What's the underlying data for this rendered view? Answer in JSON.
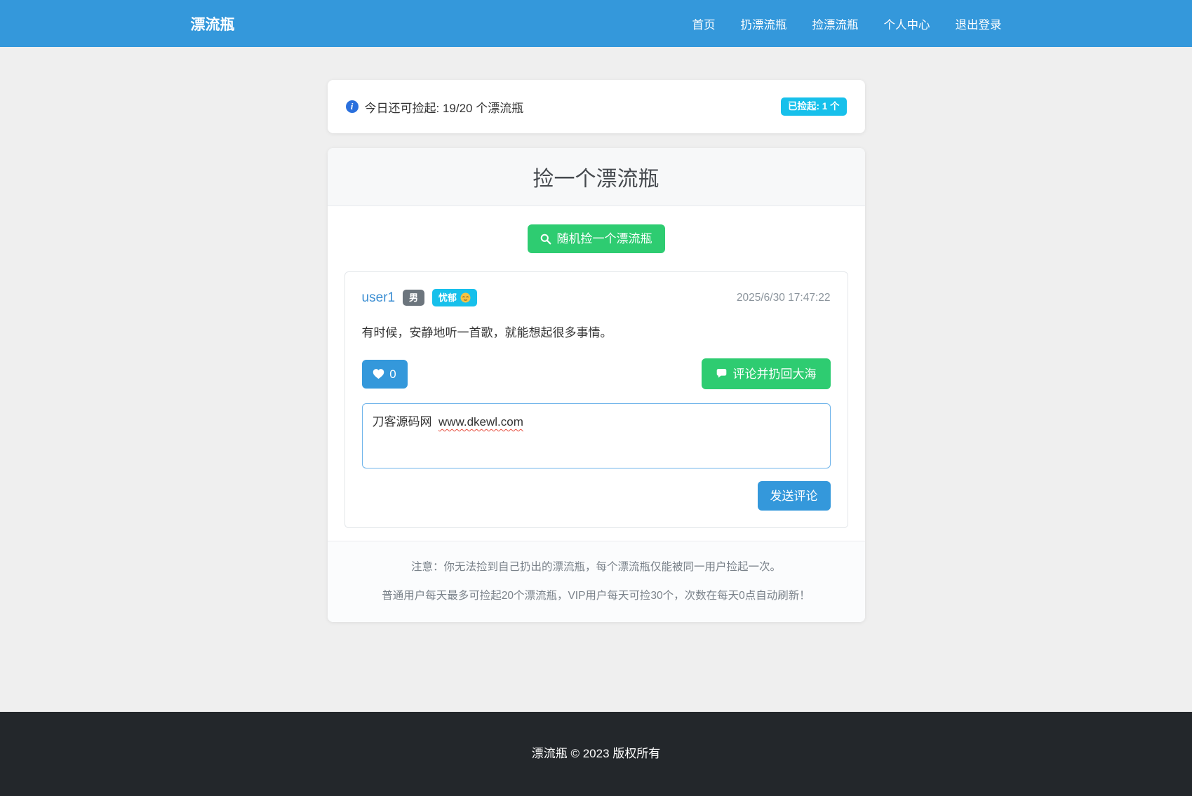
{
  "navbar": {
    "brand": "漂流瓶",
    "items": [
      {
        "label": "首页"
      },
      {
        "label": "扔漂流瓶"
      },
      {
        "label": "捡漂流瓶"
      },
      {
        "label": "个人中心"
      },
      {
        "label": "退出登录"
      }
    ]
  },
  "quota_bar": {
    "text": "今日还可捡起: 19/20 个漂流瓶",
    "badge": "已捡起: 1 个"
  },
  "pick_card": {
    "title": "捡一个漂流瓶",
    "random_button_label": "随机捡一个漂流瓶",
    "bottle": {
      "username": "user1",
      "gender_badge": "男",
      "mood_badge": "忧郁",
      "timestamp": "2025/6/30 17:47:22",
      "content": "有时候，安静地听一首歌，就能想起很多事情。",
      "like_count": "0",
      "comment_button_label": "评论并扔回大海",
      "comment_text_prefix": "刀客源码网  ",
      "comment_text_url": "www.dkewl.com",
      "send_button_label": "发送评论"
    },
    "notes": [
      "注意：你无法捡到自己扔出的漂流瓶，每个漂流瓶仅能被同一用户捡起一次。",
      "普通用户每天最多可捡起20个漂流瓶，VIP用户每天可捡30个，次数在每天0点自动刷新！"
    ]
  },
  "footer": {
    "copyright": "漂流瓶 © 2023 版权所有"
  },
  "colors": {
    "navbar_bg": "#3498db",
    "primary_blue": "#3498db",
    "success_green": "#2ecc71",
    "info_badge_cyan": "#17c0eb",
    "gender_badge_gray": "#6c757d",
    "info_icon_blue": "#2a70dd",
    "page_bg": "#efefef",
    "footer_bg": "#23272b",
    "spellcheck_red": "#e74c3c"
  }
}
